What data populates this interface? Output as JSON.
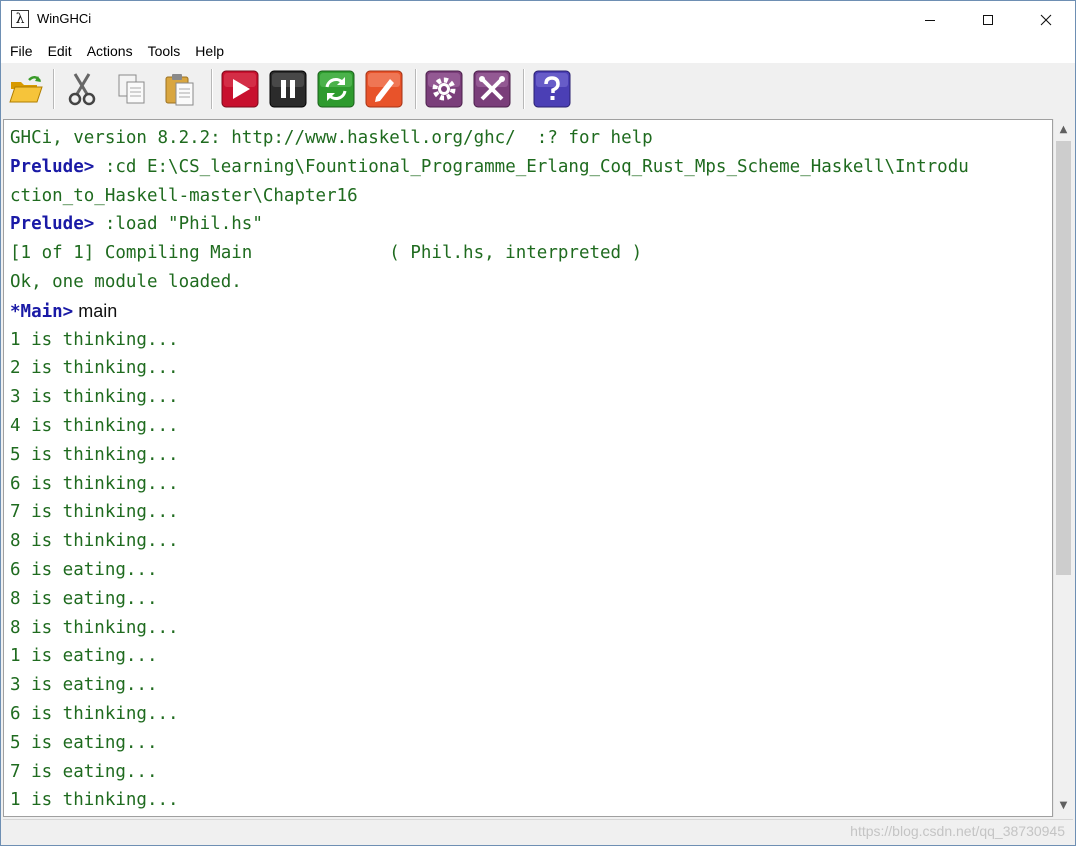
{
  "window": {
    "title": "WinGHCi",
    "app_icon_glyph": "λ"
  },
  "menu": [
    "File",
    "Edit",
    "Actions",
    "Tools",
    "Help"
  ],
  "toolbar": {
    "buttons": [
      {
        "name": "open-folder-icon",
        "color": "#f0b400"
      },
      {
        "name": "cut-icon",
        "color": "#555555"
      },
      {
        "name": "copy-icon",
        "color": "#888888"
      },
      {
        "name": "paste-icon",
        "color": "#d9a640"
      },
      {
        "name": "run-icon",
        "color": "#c8102e"
      },
      {
        "name": "pause-icon",
        "color": "#333333"
      },
      {
        "name": "reload-icon",
        "color": "#2e9b2e"
      },
      {
        "name": "edit-icon",
        "color": "#e8532a"
      },
      {
        "name": "options-gear-icon",
        "color": "#7a3e7a"
      },
      {
        "name": "tools-icon",
        "color": "#7a3e7a"
      },
      {
        "name": "help-icon",
        "color": "#4b3fb5"
      }
    ]
  },
  "console": {
    "lines": [
      {
        "prompt": "",
        "text": "GHCi, version 8.2.2: http://www.haskell.org/ghc/  :? for help"
      },
      {
        "prompt": "Prelude>",
        "text": " :cd E:\\CS_learning\\Fountional_Programme_Erlang_Coq_Rust_Mps_Scheme_Haskell\\Introdu"
      },
      {
        "prompt": "",
        "text": "ction_to_Haskell-master\\Chapter16"
      },
      {
        "prompt": "Prelude>",
        "text": " :load \"Phil.hs\""
      },
      {
        "prompt": "",
        "text": "[1 of 1] Compiling Main             ( Phil.hs, interpreted )"
      },
      {
        "prompt": "",
        "text": "Ok, one module loaded."
      },
      {
        "prompt": "*Main>",
        "typed": " main"
      },
      {
        "prompt": "",
        "text": "1 is thinking..."
      },
      {
        "prompt": "",
        "text": "2 is thinking..."
      },
      {
        "prompt": "",
        "text": "3 is thinking..."
      },
      {
        "prompt": "",
        "text": "4 is thinking..."
      },
      {
        "prompt": "",
        "text": "5 is thinking..."
      },
      {
        "prompt": "",
        "text": "6 is thinking..."
      },
      {
        "prompt": "",
        "text": "7 is thinking..."
      },
      {
        "prompt": "",
        "text": "8 is thinking..."
      },
      {
        "prompt": "",
        "text": "6 is eating..."
      },
      {
        "prompt": "",
        "text": "8 is eating..."
      },
      {
        "prompt": "",
        "text": "8 is thinking..."
      },
      {
        "prompt": "",
        "text": "1 is eating..."
      },
      {
        "prompt": "",
        "text": "3 is eating..."
      },
      {
        "prompt": "",
        "text": "6 is thinking..."
      },
      {
        "prompt": "",
        "text": "5 is eating..."
      },
      {
        "prompt": "",
        "text": "7 is eating..."
      },
      {
        "prompt": "",
        "text": "1 is thinking..."
      }
    ]
  },
  "scrollbar": {
    "up_glyph": "▲",
    "down_glyph": "▼"
  },
  "status": {
    "watermark": "https://blog.csdn.net/qq_38730945"
  }
}
